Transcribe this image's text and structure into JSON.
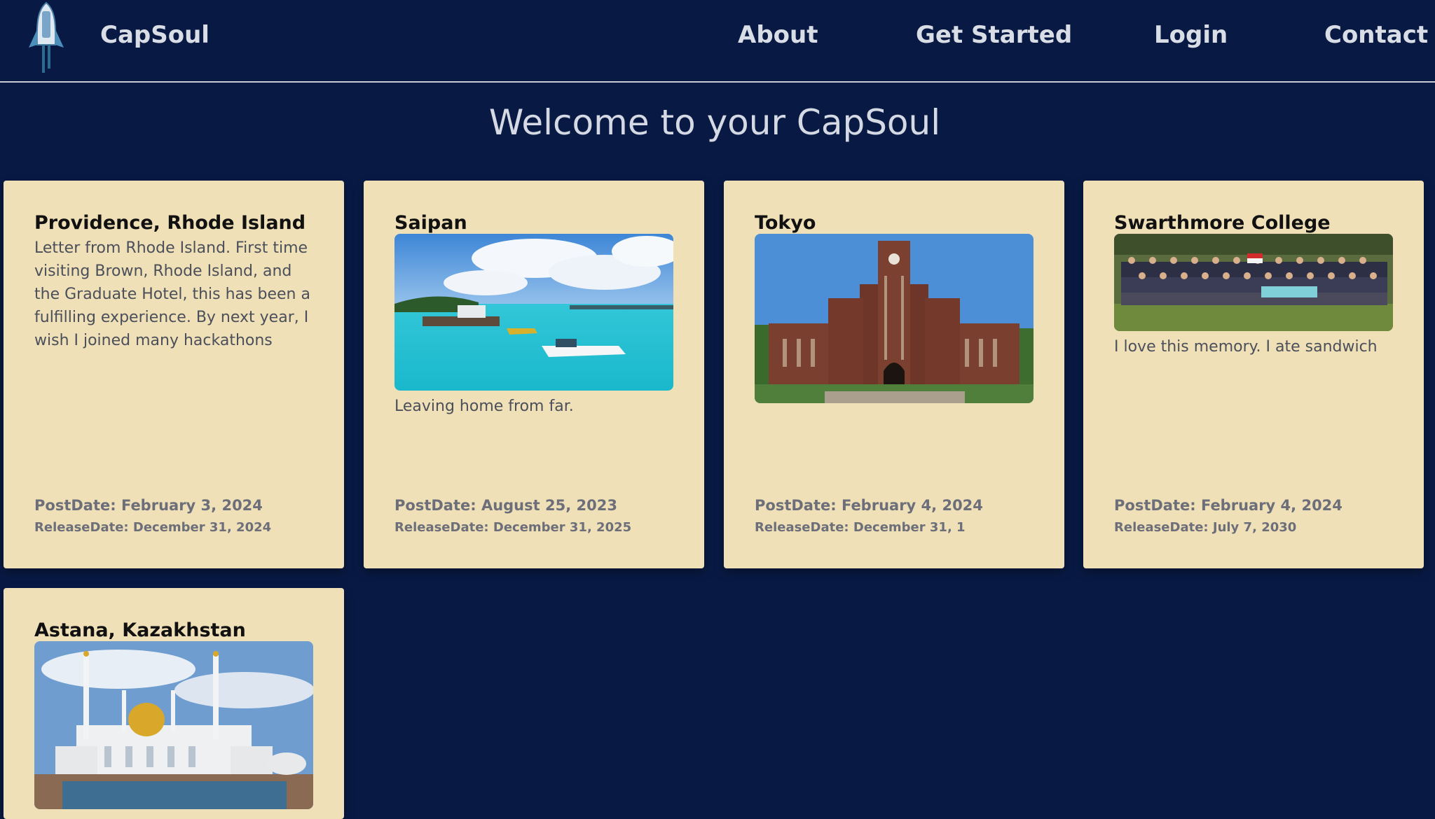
{
  "nav": {
    "brand": "CapSoul",
    "logo_icon": "rocket-icon",
    "links": [
      "About",
      "Get Started",
      "Login",
      "Contact"
    ]
  },
  "heading": "Welcome to your CapSoul",
  "colors": {
    "background": "#081a44",
    "card": "#f0e0b8",
    "nav_text": "#d9dde6"
  },
  "cards": [
    {
      "title": "Providence, Rhode Island",
      "text": "Letter from Rhode Island. First time visiting Brown, Rhode Island, and the Graduate Hotel, this has been a fulfilling experience. By next year, I wish I joined many hackathons",
      "post_date": "PostDate: February 3, 2024",
      "release_date": "ReleaseDate: December 31, 2024"
    },
    {
      "title": "Saipan",
      "text": "Leaving home from far.",
      "post_date": "PostDate: August 25, 2023",
      "release_date": "ReleaseDate: December 31, 2025"
    },
    {
      "title": "Tokyo",
      "text": "",
      "post_date": "PostDate: February 4, 2024",
      "release_date": "ReleaseDate: December 31, 1"
    },
    {
      "title": "Swarthmore College",
      "text": "I love this memory. I ate sandwich",
      "post_date": "PostDate: February 4, 2024",
      "release_date": "ReleaseDate: July 7, 2030"
    },
    {
      "title": "Astana, Kazakhstan",
      "text": ""
    }
  ]
}
